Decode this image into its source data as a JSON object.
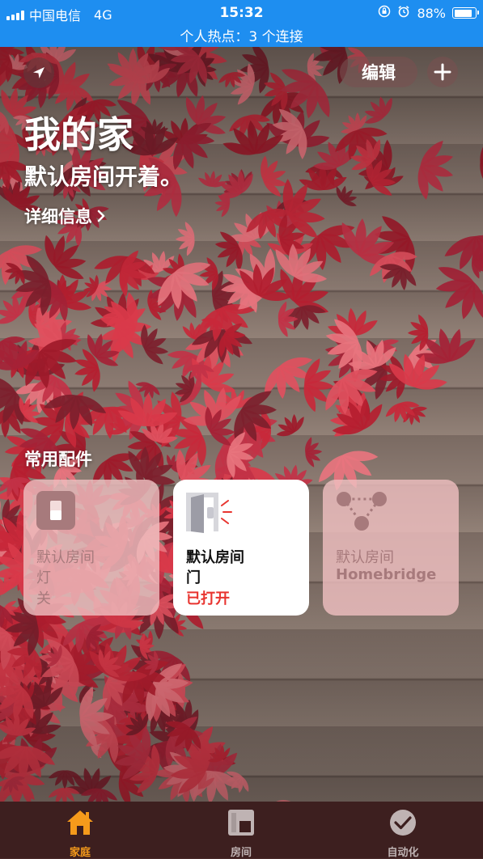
{
  "status_bar": {
    "carrier": "中国电信",
    "network": "4G",
    "time": "15:32",
    "battery": "88%",
    "battery_level": 0.88,
    "hotspot": "个人热点：3 个连接"
  },
  "header": {
    "edit_label": "编辑",
    "title": "我的家",
    "status": "默认房间开着。",
    "details_label": "详细信息"
  },
  "favorites": {
    "section_title": "常用配件",
    "tiles": [
      {
        "room": "默认房间",
        "name": "灯",
        "state": "关",
        "icon": "light-switch-icon"
      },
      {
        "room": "默认房间",
        "name": "门",
        "state": "已打开",
        "icon": "door-open-icon"
      },
      {
        "room": "默认房间",
        "name": "Homebridge",
        "state": "",
        "icon": "hub-icon"
      }
    ]
  },
  "tabs": [
    {
      "label": "家庭",
      "icon": "house-icon",
      "active": true
    },
    {
      "label": "房间",
      "icon": "rooms-icon",
      "active": false
    },
    {
      "label": "自动化",
      "icon": "automation-icon",
      "active": false
    }
  ],
  "colors": {
    "status_bar": "#1e8ef0",
    "active_tab": "#f59a1b",
    "inactive_tab": "#bfb3b3",
    "door_open": "#e8342f"
  }
}
